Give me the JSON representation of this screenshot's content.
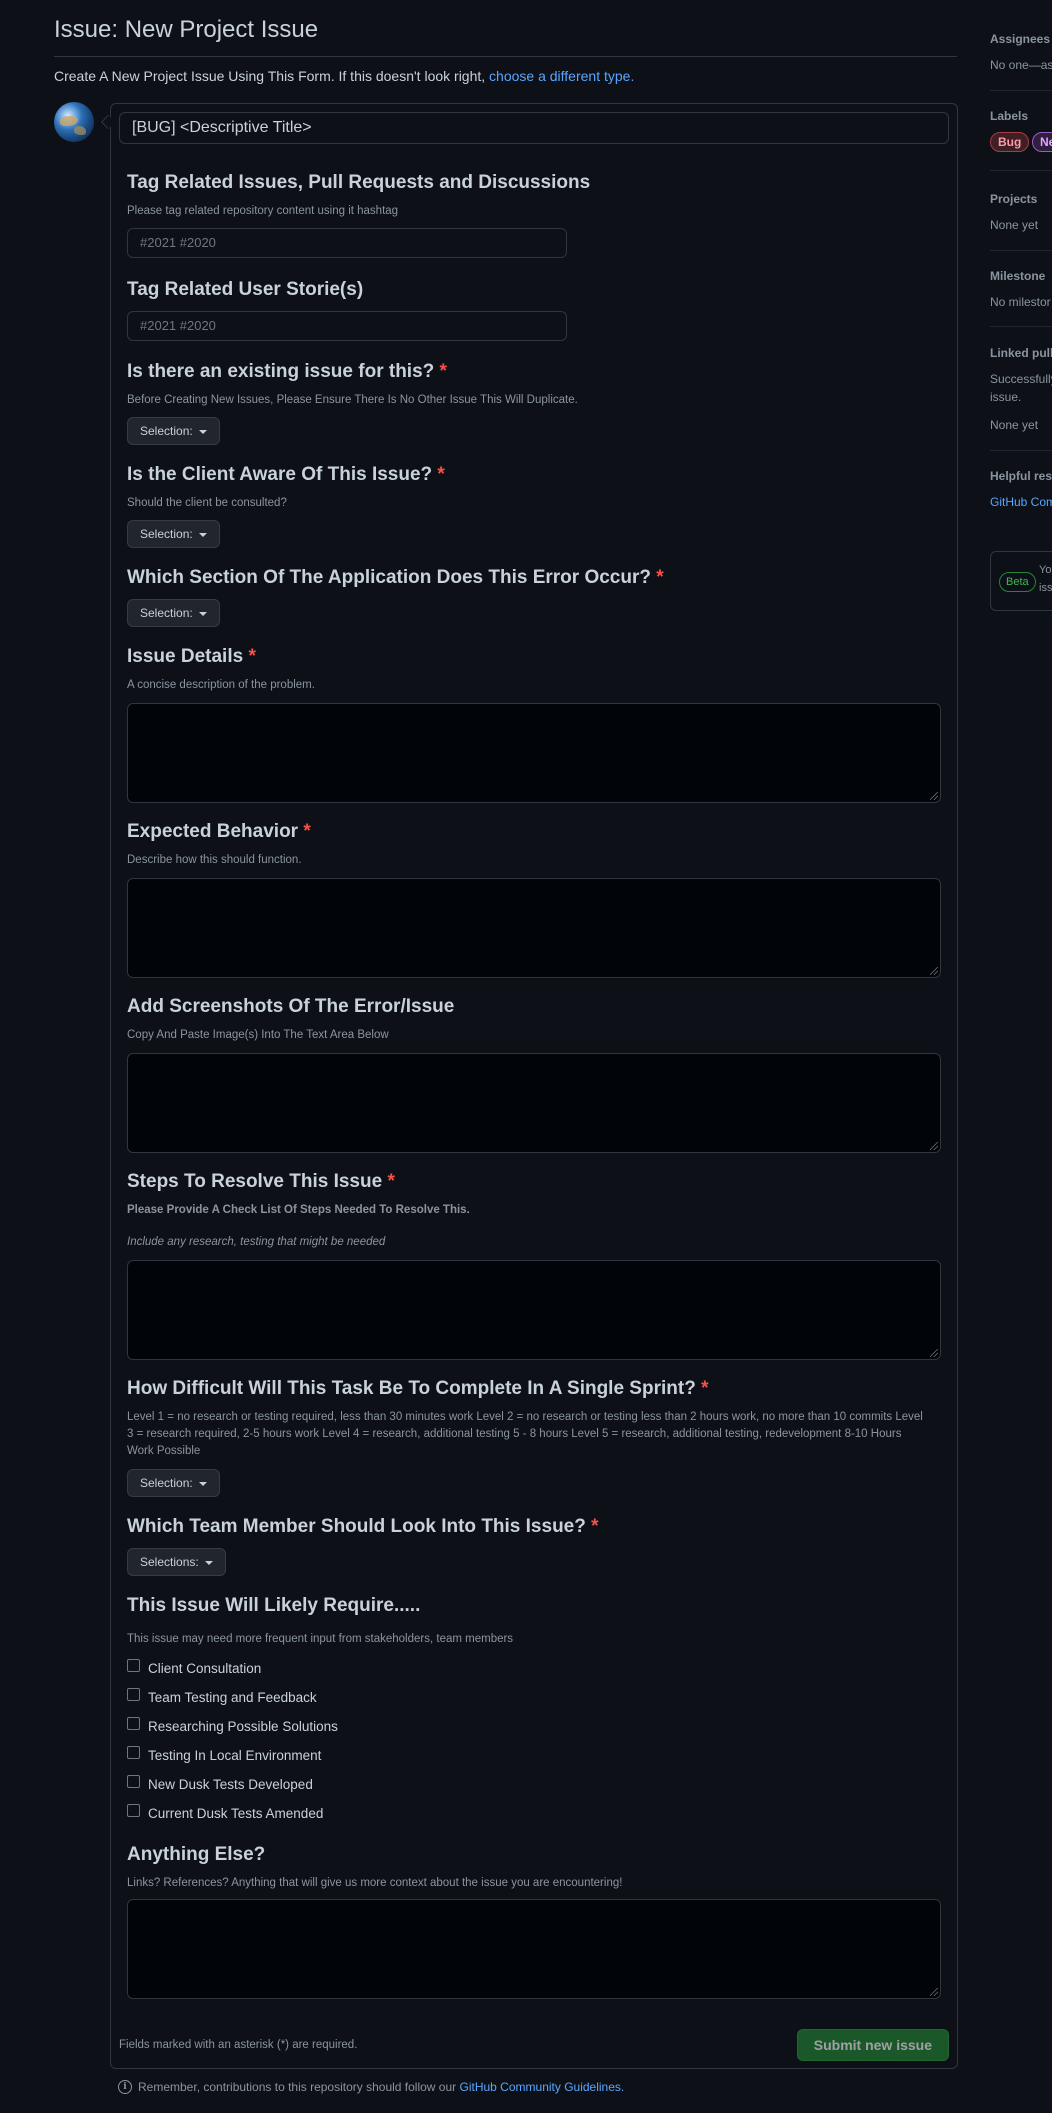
{
  "header": {
    "title": "Issue: New Project Issue",
    "subtitle_prefix": "Create A New Project Issue Using This Form. If this doesn't look right,",
    "subtitle_link": "choose a different type."
  },
  "form": {
    "title_value": "[BUG] <Descriptive Title>",
    "fields": {
      "tag_related": {
        "label": "Tag Related Issues, Pull Requests and Discussions",
        "description": "Please tag related repository content using it hashtag",
        "placeholder": "#2021 #2020"
      },
      "user_stories": {
        "label": "Tag Related User Storie(s)",
        "placeholder": "#2021 #2020"
      },
      "existing_issue": {
        "label": "Is there an existing issue for this?",
        "required": "*",
        "description": "Before Creating New Issues, Please Ensure There Is No Other Issue This Will Duplicate.",
        "select": "Selection:"
      },
      "client_aware": {
        "label": "Is the Client Aware Of This Issue?",
        "required": "*",
        "description": "Should the client be consulted?",
        "select": "Selection:"
      },
      "app_section": {
        "label": "Which Section Of The Application Does This Error Occur?",
        "required": "*",
        "select": "Selection:"
      },
      "issue_details": {
        "label": "Issue Details",
        "required": "*",
        "description": "A concise description of the problem."
      },
      "expected_behavior": {
        "label": "Expected Behavior",
        "required": "*",
        "description": "Describe how this should function."
      },
      "screenshots": {
        "label": "Add Screenshots Of The Error/Issue",
        "description": "Copy And Paste Image(s) Into The Text Area Below"
      },
      "steps": {
        "label": "Steps To Resolve This Issue",
        "required": "*",
        "description_bold": "Please Provide A Check List Of Steps Needed To Resolve This.",
        "description_italic": "Include any research, testing that might be needed"
      },
      "difficulty": {
        "label": "How Difficult Will This Task Be To Complete In A Single Sprint?",
        "required": "*",
        "description": "Level 1 = no research or testing required, less than 30 minutes work Level 2 = no research or testing less than 2 hours work, no more than 10 commits Level 3 = research required, 2-5 hours work Level 4 = research, additional testing 5 - 8 hours Level 5 = research, additional testing, redevelopment 8-10 Hours Work Possible",
        "select": "Selection:"
      },
      "team_member": {
        "label": "Which Team Member Should Look Into This Issue?",
        "required": "*",
        "select": "Selections:"
      },
      "likely_require": {
        "label": "This Issue Will Likely Require.....",
        "description": "This issue may need more frequent input from stakeholders, team members",
        "options": [
          "Client Consultation",
          "Team Testing and Feedback",
          "Researching Possible Solutions",
          "Testing In Local Environment",
          "New Dusk Tests Developed",
          "Current Dusk Tests Amended"
        ]
      },
      "anything_else": {
        "label": "Anything Else?",
        "description": "Links? References? Anything that will give us more context about the issue you are encountering!"
      }
    },
    "footer_note": "Fields marked with an asterisk (*) are required.",
    "submit_label": "Submit new issue"
  },
  "bottom_note": {
    "prefix": "Remember, contributions to this repository should follow our",
    "link": "GitHub Community Guidelines."
  },
  "sidebar": {
    "assignees": {
      "heading": "Assignees",
      "value": "No one—as"
    },
    "labels": {
      "heading": "Labels",
      "items": [
        "Bug",
        "Ne"
      ]
    },
    "projects": {
      "heading": "Projects",
      "value": "None yet"
    },
    "milestone": {
      "heading": "Milestone",
      "value": "No milestor"
    },
    "linked_pull": {
      "heading": "Linked pull",
      "line1": "Successfully",
      "line2": "issue.",
      "value": "None yet"
    },
    "helpful": {
      "heading": "Helpful reso",
      "link": "GitHub Com"
    },
    "beta": {
      "badge": "Beta",
      "line1": "Yo",
      "line2": "iss"
    }
  },
  "colors": {
    "background": "#0d1117",
    "accent_link": "#58a6ff",
    "required": "#f85149",
    "submit": "#238636"
  }
}
